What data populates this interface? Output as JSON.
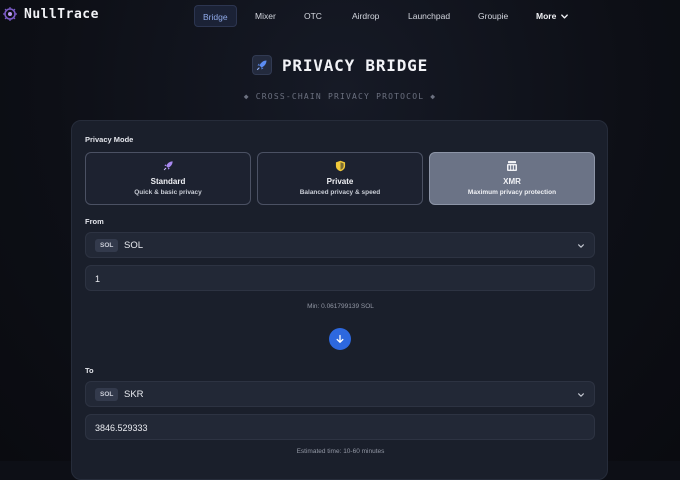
{
  "app": {
    "name": "NullTrace"
  },
  "nav": {
    "items": [
      {
        "label": "Bridge",
        "active": true
      },
      {
        "label": "Mixer"
      },
      {
        "label": "OTC"
      },
      {
        "label": "Airdrop"
      },
      {
        "label": "Launchpad"
      },
      {
        "label": "Groupie"
      }
    ],
    "more_label": "More"
  },
  "header": {
    "title": "PRIVACY BRIDGE",
    "subtitle": "◆ CROSS-CHAIN PRIVACY PROTOCOL ◆"
  },
  "form": {
    "privacy_mode_label": "Privacy Mode",
    "modes": [
      {
        "title": "Standard",
        "desc": "Quick & basic privacy",
        "icon": "rocket-icon"
      },
      {
        "title": "Private",
        "desc": "Balanced privacy & speed",
        "icon": "shield-icon"
      },
      {
        "title": "XMR",
        "desc": "Maximum privacy protection",
        "icon": "vault-icon",
        "selected": true
      }
    ],
    "from_label": "From",
    "from_token": {
      "chain": "SOL",
      "name": "SOL"
    },
    "from_amount": "1",
    "min_note": "Min: 0.061799139 SOL",
    "to_label": "To",
    "to_token": {
      "chain": "SOL",
      "name": "SKR"
    },
    "to_amount": "3846.529333",
    "estimate_note": "Estimated time: 10-60 minutes"
  },
  "colors": {
    "accent": "#2d68df",
    "background": "#0d0f16",
    "card": "#1a1f2b",
    "selected_mode": "#6b7386"
  }
}
